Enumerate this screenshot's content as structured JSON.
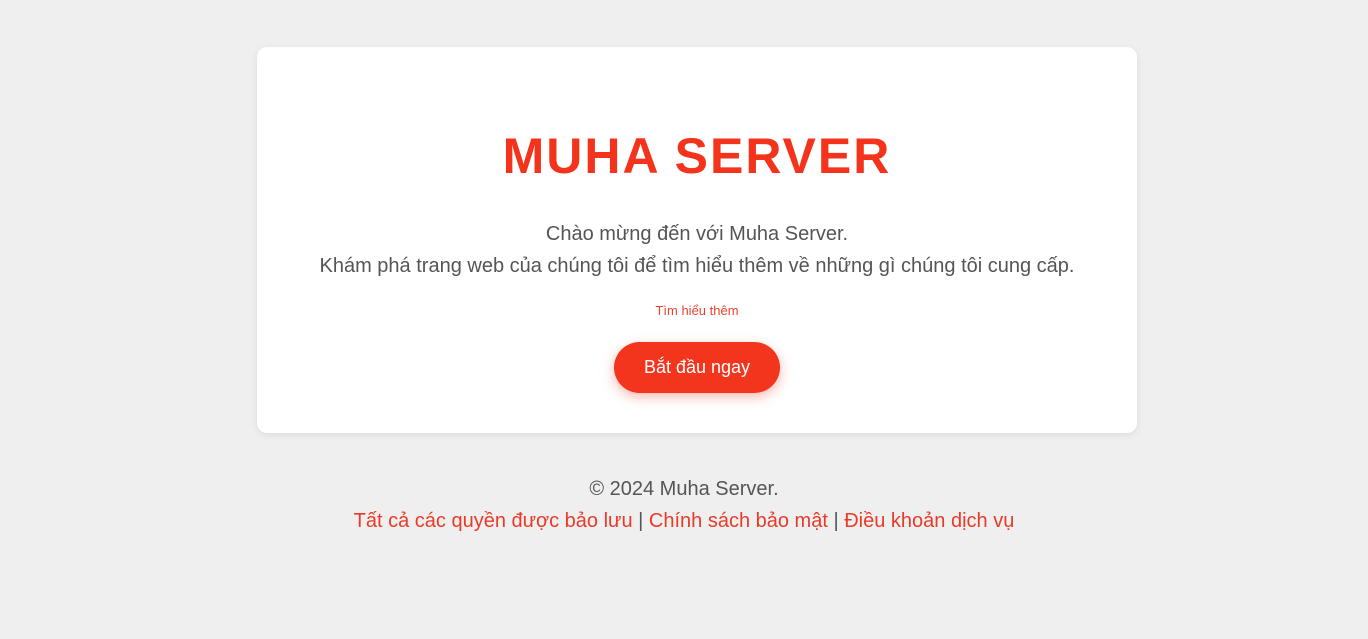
{
  "hero": {
    "title": "MUHA SERVER",
    "welcome_line1": "Chào mừng đến với Muha Server.",
    "welcome_line2": "Khám phá trang web của chúng tôi để tìm hiểu thêm về những gì chúng tôi cung cấp.",
    "learn_more_label": "Tìm hiểu thêm",
    "cta_label": "Bắt đầu ngay"
  },
  "footer": {
    "copyright": "© 2024 Muha Server.",
    "links": [
      "Tất cả các quyền được bảo lưu",
      "Chính sách bảo mật",
      "Điều khoản dịch vụ"
    ],
    "separator": "|"
  },
  "colors": {
    "accent": "#f4331c",
    "background": "#efefef",
    "card": "#ffffff",
    "text": "#555555"
  }
}
